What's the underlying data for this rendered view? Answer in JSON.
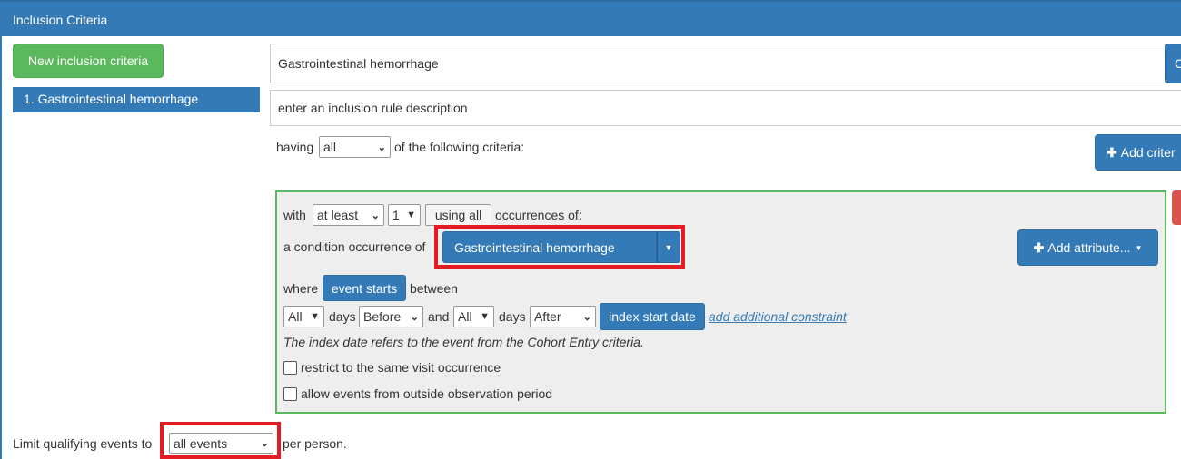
{
  "header": {
    "title": "Inclusion Criteria"
  },
  "sidebar": {
    "new_button": "New inclusion criteria",
    "items": [
      {
        "label": "1. Gastrointestinal hemorrhage"
      }
    ]
  },
  "rule": {
    "name": "Gastrointestinal hemorrhage",
    "description_placeholder": "enter an inclusion rule description",
    "copy_button_partial": "C",
    "having_prefix": "having",
    "having_value": "all",
    "having_suffix": "of the following criteria:",
    "add_criteria_button": "Add criter"
  },
  "criteria": {
    "with_label": "with",
    "count_type": "at least",
    "count_value": "1",
    "using_button": "using all",
    "occurrences_label": "occurrences of:",
    "condition_label": "a condition occurrence of",
    "concept_set": "Gastrointestinal hemorrhage",
    "add_attribute_button": "Add attribute...",
    "where_label": "where",
    "event_starts_button": "event starts",
    "between_label": "between",
    "start_days": "All",
    "days_label_1": "days",
    "start_direction": "Before",
    "and_label": "and",
    "end_days": "All",
    "days_label_2": "days",
    "end_direction": "After",
    "index_button": "index start date",
    "add_constraint_link": "add additional constraint",
    "note": "The index date refers to the event from the Cohort Entry criteria.",
    "restrict_visit_label": "restrict to the same visit occurrence",
    "outside_observation_label": "allow events from outside observation period"
  },
  "limit": {
    "prefix": "Limit qualifying events to",
    "value": "all events",
    "suffix": "per person."
  },
  "colors": {
    "primary": "#337ab7",
    "success": "#5cb85c",
    "highlight": "#e31b23",
    "danger": "#d9534f"
  }
}
